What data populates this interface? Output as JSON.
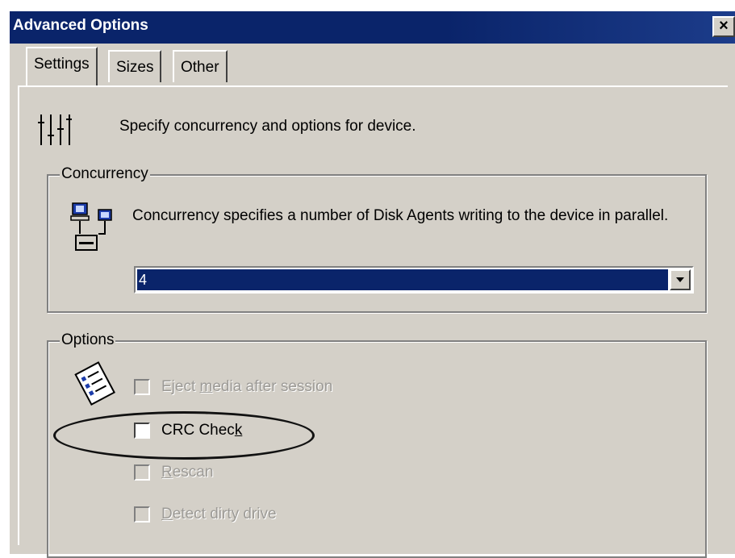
{
  "window": {
    "title": "Advanced Options",
    "close_label": "×"
  },
  "tabs": [
    {
      "label": "Settings",
      "active": true
    },
    {
      "label": "Sizes",
      "active": false
    },
    {
      "label": "Other",
      "active": false
    }
  ],
  "header": {
    "text": "Specify concurrency and options for device.",
    "icon": "sliders-icon"
  },
  "concurrency": {
    "legend": "Concurrency",
    "description": "Concurrency specifies a number of Disk Agents writing to the device in parallel.",
    "icon": "network-computers-icon",
    "select_value": "4"
  },
  "options": {
    "legend": "Options",
    "icon": "checklist-icon",
    "items": [
      {
        "prefix": "Eject ",
        "mnemonic": "m",
        "suffix": "edia after session",
        "checked": false,
        "enabled": false
      },
      {
        "prefix": "CRC Chec",
        "mnemonic": "k",
        "suffix": "",
        "checked": false,
        "enabled": true
      },
      {
        "prefix": "",
        "mnemonic": "R",
        "suffix": "escan",
        "checked": false,
        "enabled": false
      },
      {
        "prefix": "",
        "mnemonic": "D",
        "suffix": "etect dirty drive",
        "checked": false,
        "enabled": false
      }
    ]
  },
  "colors": {
    "titlebar": "#0a246a",
    "face": "#d4d0c8",
    "highlight": "#0a246a"
  }
}
